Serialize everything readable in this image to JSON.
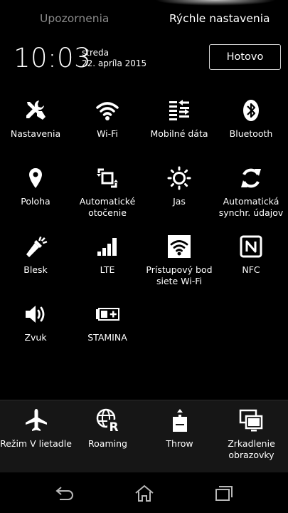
{
  "tabs": {
    "notifications": "Upozornenia",
    "quick_settings": "Rýchle nastavenia"
  },
  "header": {
    "time": "10:03",
    "day": "streda",
    "date": "22. apríla 2015",
    "done_label": "Hotovo"
  },
  "tiles": [
    {
      "label": "Nastavenia",
      "icon": "wrench-screwdriver-icon"
    },
    {
      "label": "Wi-Fi",
      "icon": "wifi-icon"
    },
    {
      "label": "Mobilné dáta",
      "icon": "mobile-data-icon"
    },
    {
      "label": "Bluetooth",
      "icon": "bluetooth-icon"
    },
    {
      "label": "Poloha",
      "icon": "location-pin-icon"
    },
    {
      "label": "Automatické\notočenie",
      "icon": "auto-rotate-icon"
    },
    {
      "label": "Jas",
      "icon": "brightness-icon"
    },
    {
      "label": "Automatická\nsynchr. údajov",
      "icon": "sync-icon"
    },
    {
      "label": "Blesk",
      "icon": "flashlight-icon"
    },
    {
      "label": "LTE",
      "icon": "signal-bars-icon"
    },
    {
      "label": "Prístupový bod\nsiete Wi-Fi",
      "icon": "hotspot-icon"
    },
    {
      "label": "NFC",
      "icon": "nfc-icon"
    },
    {
      "label": "Zvuk",
      "icon": "speaker-icon"
    },
    {
      "label": "STAMINA",
      "icon": "stamina-battery-icon"
    }
  ],
  "bottom_bar": [
    {
      "label": "Režim V lietadle",
      "icon": "airplane-icon"
    },
    {
      "label": "Roaming",
      "icon": "roaming-globe-icon"
    },
    {
      "label": "Throw",
      "icon": "throw-icon"
    },
    {
      "label": "Zrkadlenie\nobrazovky",
      "icon": "screen-mirroring-icon"
    }
  ],
  "nav": [
    {
      "icon": "back-icon"
    },
    {
      "icon": "home-icon"
    },
    {
      "icon": "recent-apps-icon"
    }
  ],
  "colors": {
    "background": "#000000",
    "bottom_bar": "#161616",
    "inactive_tab": "#8a8a8a",
    "text": "#ffffff"
  }
}
